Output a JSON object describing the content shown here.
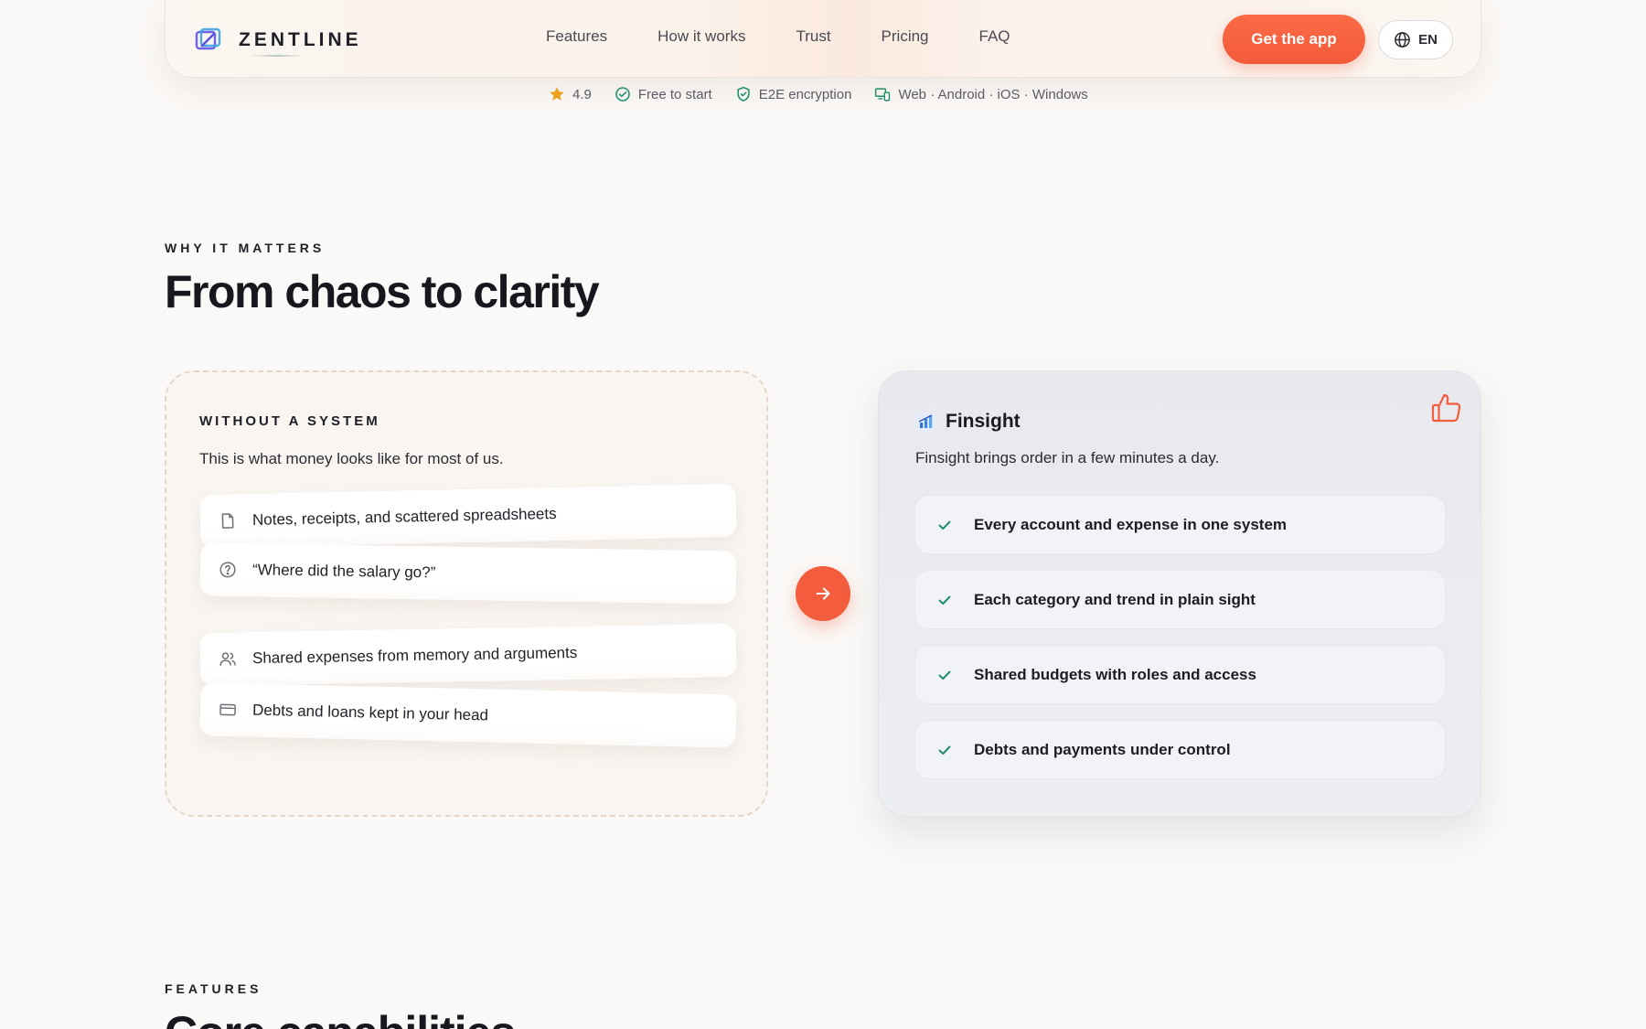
{
  "brand": {
    "name": "ZENTLINE"
  },
  "nav": {
    "links": [
      "Features",
      "How it works",
      "Trust",
      "Pricing",
      "FAQ"
    ],
    "cta": "Get the app",
    "lang": "EN"
  },
  "trust": {
    "rating": "4.9",
    "free": "Free to start",
    "encryption": "E2E encryption",
    "platforms": "Web · Android · iOS · Windows"
  },
  "why": {
    "eyebrow": "WHY IT MATTERS",
    "title": "From chaos to clarity",
    "without": {
      "label": "WITHOUT A SYSTEM",
      "subtitle": "This is what money looks like for most of us.",
      "items": [
        {
          "text": "Notes, receipts, and scattered spreadsheets",
          "icon": "document-icon"
        },
        {
          "text": "“Where did the salary go?”",
          "icon": "question-icon"
        },
        {
          "text": "Shared expenses from memory and arguments",
          "icon": "users-icon"
        },
        {
          "text": "Debts and loans kept in your head",
          "icon": "card-icon"
        }
      ]
    },
    "with": {
      "name": "Finsight",
      "subtitle": "Finsight brings order in a few minutes a day.",
      "items": [
        "Every account and expense in one system",
        "Each category and trend in plain sight",
        "Shared budgets with roles and access",
        "Debts and payments under control"
      ]
    }
  },
  "features": {
    "eyebrow": "FEATURES",
    "title": "Core capabilities"
  },
  "colors": {
    "accent": "#f35d3d",
    "check": "#1f8f6a",
    "background": "#fbf9f7"
  }
}
